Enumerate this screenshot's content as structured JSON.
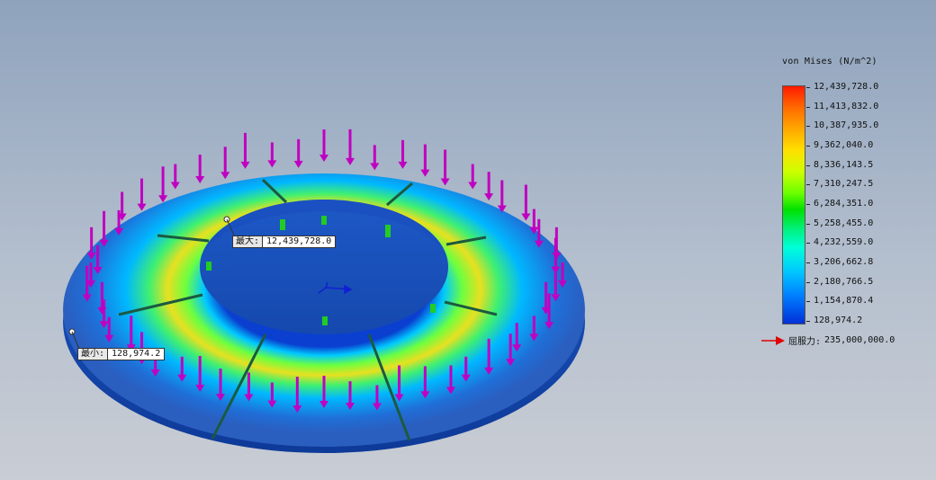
{
  "legend": {
    "title": "von Mises (N/m^2)",
    "ticks": [
      "12,439,728.0",
      "11,413,832.0",
      "10,387,935.0",
      "9,362,040.0",
      "8,336,143.5",
      "7,310,247.5",
      "6,284,351.0",
      "5,258,455.0",
      "4,232,559.0",
      "3,206,662.8",
      "2,180,766.5",
      "1,154,870.4",
      "128,974.2"
    ],
    "yield_label": "屈服力:",
    "yield_value": "235,000,000.0",
    "yield_arrow_color": "#e00000"
  },
  "probes": {
    "max": {
      "label": "最大:",
      "value": "12,439,728.0"
    },
    "min": {
      "label": "最小:",
      "value": "128,974.2"
    }
  },
  "colors": {
    "load_arrow": "#c000c0",
    "fixture": "#22cc22",
    "ring_outer": "#1f6fd8",
    "ring_mid": "#e8e020",
    "triad": "#1020d0"
  }
}
